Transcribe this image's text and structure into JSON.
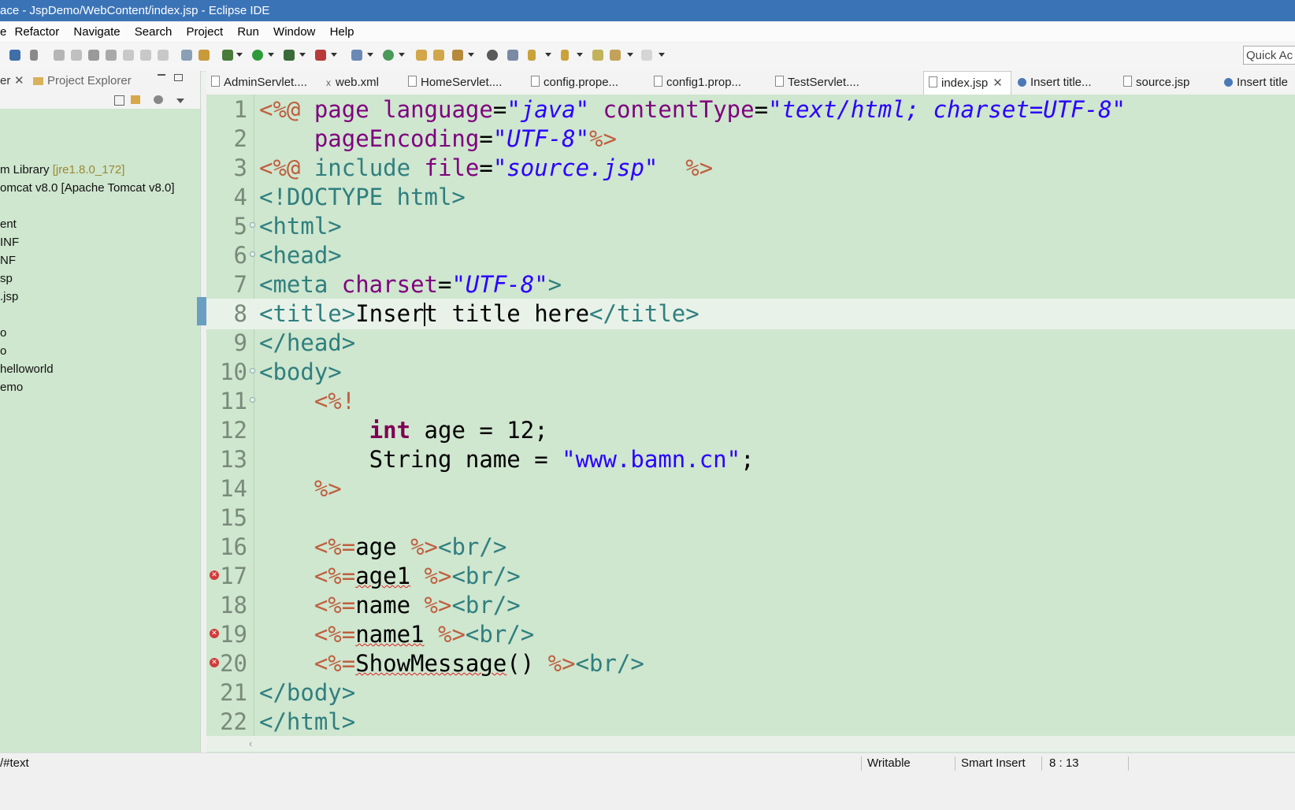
{
  "window": {
    "title": "ace - JspDemo/WebContent/index.jsp - Eclipse IDE"
  },
  "menu": [
    "e",
    "Refactor",
    "Navigate",
    "Search",
    "Project",
    "Run",
    "Window",
    "Help"
  ],
  "toolbar": {
    "quick_access": "Quick Ac"
  },
  "left_panel": {
    "tab_partial": "er",
    "tab_project_explorer": "Project Explorer",
    "tree": [
      "m Library",
      "[jre1.8.0_172]",
      "omcat v8.0 [Apache Tomcat v8.0]",
      "ent",
      "INF",
      "NF",
      "sp",
      ".jsp",
      "o",
      "o",
      "helloworld",
      "emo"
    ]
  },
  "editor_tabs": [
    {
      "label": "AdminServlet...."
    },
    {
      "label": "web.xml"
    },
    {
      "label": "HomeServlet...."
    },
    {
      "label": "config.prope..."
    },
    {
      "label": "config1.prop..."
    },
    {
      "label": "TestServlet...."
    },
    {
      "label": "index.jsp"
    },
    {
      "label": "Insert title..."
    },
    {
      "label": "source.jsp"
    },
    {
      "label": "Insert title"
    }
  ],
  "code": {
    "line_numbers": [
      "1",
      "2",
      "3",
      "4",
      "5",
      "6",
      "7",
      "8",
      "9",
      "10",
      "11",
      "12",
      "13",
      "14",
      "15",
      "16",
      "17",
      "18",
      "19",
      "20",
      "21",
      "22"
    ],
    "l1": {
      "a": "<%@",
      "b": " page ",
      "c": "language",
      "d": "=",
      "e": "\"java\"",
      "f": " contentType",
      "g": "=",
      "h": "\"text/html; charset=UTF-8\""
    },
    "l2": {
      "a": "    pageEncoding",
      "b": "=",
      "c": "\"UTF-8\"",
      "d": "%>"
    },
    "l3": {
      "a": "<%@",
      "b": " include ",
      "c": "file",
      "d": "=",
      "e": "\"source.jsp\"",
      "f": "  %>"
    },
    "l4": "<!DOCTYPE html>",
    "l5": "<html>",
    "l6": "<head>",
    "l7": {
      "a": "<meta ",
      "b": "charset",
      "c": "=",
      "d": "\"UTF-8\"",
      "e": ">"
    },
    "l8": {
      "a": "<title>",
      "b": "Inser",
      "b2": "t title here",
      "c": "</title>"
    },
    "l9": "</head>",
    "l10": "<body>",
    "l11": "    <%!",
    "l12": {
      "indent": "        ",
      "kw": "int",
      "rest": " age = 12;"
    },
    "l13": {
      "a": "        String name = ",
      "b": "\"www.bamn.cn\"",
      "c": ";"
    },
    "l14": "    %>",
    "l15": "",
    "l16": {
      "a": "    <%=",
      "b": "age ",
      "c": "%>",
      "d": "<br/>"
    },
    "l17": {
      "a": "    <%=",
      "b": "age1",
      "b2": " ",
      "c": "%>",
      "d": "<br/>"
    },
    "l18": {
      "a": "    <%=",
      "b": "name ",
      "c": "%>",
      "d": "<br/>"
    },
    "l19": {
      "a": "    <%=",
      "b": "name1",
      "b2": " ",
      "c": "%>",
      "d": "<br/>"
    },
    "l20": {
      "a": "    <%=",
      "b": "ShowMessage",
      "b2": "() ",
      "c": "%>",
      "d": "<br/>"
    },
    "l21": "</body>",
    "l22": "</html>"
  },
  "status": {
    "path": "/#text",
    "writable": "Writable",
    "insert_mode": "Smart Insert",
    "position": "8 : 13"
  },
  "colors": {
    "editor_bg": "#cfe6cf",
    "tag": "#2f7f7f",
    "attr": "#7f007f",
    "string": "#2a00ff",
    "jsp_delim": "#bf5f3f",
    "keyword": "#7f0055",
    "titlebar": "#3b74b6"
  }
}
